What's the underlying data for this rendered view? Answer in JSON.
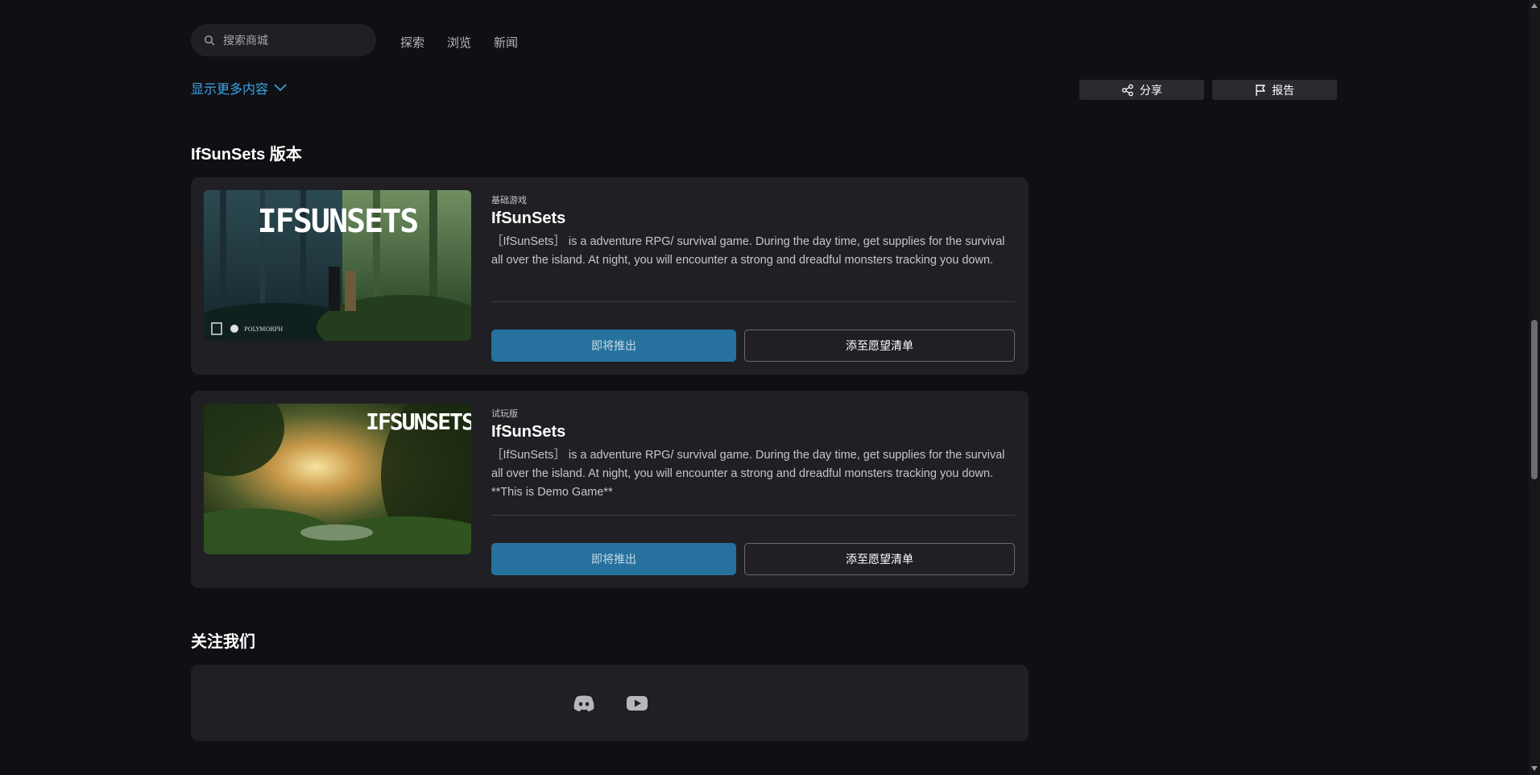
{
  "nav": {
    "search_placeholder": "搜索商城",
    "links": [
      "探索",
      "浏览",
      "新闻"
    ]
  },
  "description": {
    "show_more": "显示更多内容"
  },
  "side_actions": {
    "share": "分享",
    "report": "报告"
  },
  "editions": {
    "title": "IfSunSets 版本",
    "items": [
      {
        "edition": "基础游戏",
        "name": "IfSunSets",
        "description": "［IfSunSets］ is a adventure RPG/ survival game. During the day time, get supplies for the survival all over the island. At night, you will encounter a strong and dreadful monsters tracking you down.",
        "primary_button": "即将推出",
        "wishlist_button": "添至愿望清单",
        "thumb_logo": "IFSUNSETS",
        "thumb_badge": "POLYMORPH"
      },
      {
        "edition": "试玩版",
        "name": "IfSunSets",
        "description": "［IfSunSets］ is a adventure RPG/ survival game. During the day time, get supplies for the survival all over the island. At night, you will encounter a strong and dreadful monsters tracking you down. **This is Demo Game**",
        "primary_button": "即将推出",
        "wishlist_button": "添至愿望清单",
        "thumb_logo": "IFSUNSETS"
      }
    ]
  },
  "follow": {
    "title": "关注我们",
    "icons": [
      "discord-icon",
      "youtube-icon"
    ]
  },
  "colors": {
    "background": "#101014",
    "card": "#202024",
    "accent_link": "#3aa4e8",
    "primary_button": "#26719e"
  }
}
